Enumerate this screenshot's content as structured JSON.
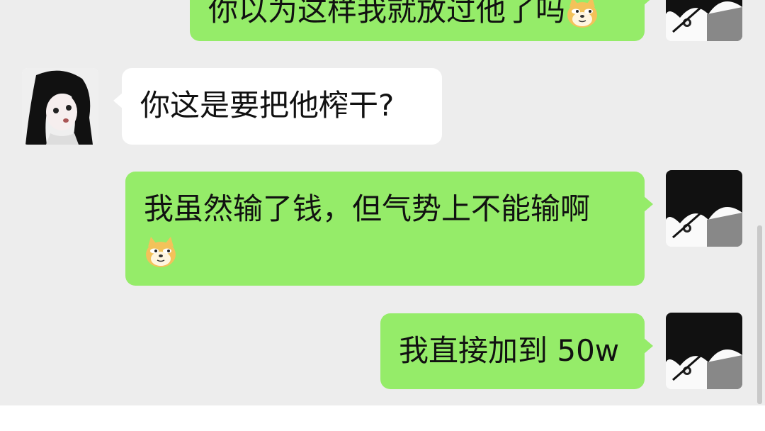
{
  "chat": {
    "messages": [
      {
        "direction": "sent",
        "text": "你以为这样我就放过他了吗",
        "emoji": "doge-emoji"
      },
      {
        "direction": "received",
        "text": "你这是要把他榨干?"
      },
      {
        "direction": "sent",
        "text": "我虽然输了钱，但气势上不能输啊",
        "emoji": "doge-emoji"
      },
      {
        "direction": "sent",
        "text": "我直接加到 50w"
      }
    ]
  },
  "colors": {
    "background": "#ededed",
    "sent_bubble": "#95ec69",
    "received_bubble": "#ffffff"
  }
}
